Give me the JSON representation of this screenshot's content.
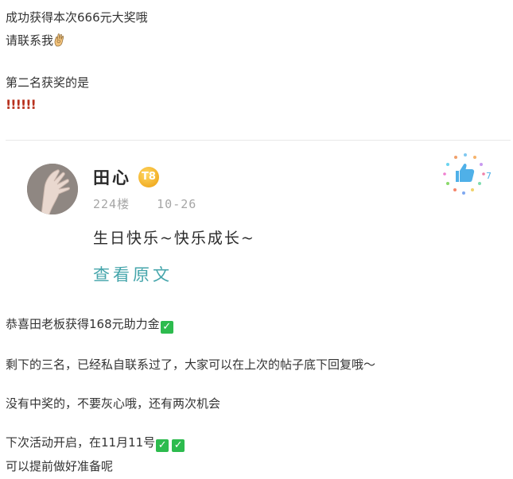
{
  "post": {
    "line1": "成功获得本次666元大奖哦",
    "line2": "请联系我",
    "line2_emoji": "ok-hand-icon",
    "line3": "第二名获奖的是",
    "line4": "!!!!!!"
  },
  "quoted_comment": {
    "author": "田心",
    "badge": "T8",
    "floor": "224楼",
    "date": "10-26",
    "content": "生日快乐~快乐成长~",
    "view_original_label": "查看原文",
    "like_icon": "thumbs-up-icon"
  },
  "post_after": {
    "congrats": "恭喜田老板获得168元助力金",
    "remaining": "剩下的三名，已经私自联系过了，大家可以在上次的帖子底下回复哦～",
    "encourage": "没有中奖的，不要灰心哦，还有两次机会",
    "next_event": "下次活动开启，在11月11号",
    "prepare": "可以提前做好准备呢",
    "check_icon": "✓"
  },
  "colors": {
    "text": "#333333",
    "link": "#45a5ab",
    "check_bg": "#2dbb4e",
    "exclaim": "#b8321e",
    "badge": "#f0a91e",
    "meta": "#a6a6a6"
  }
}
